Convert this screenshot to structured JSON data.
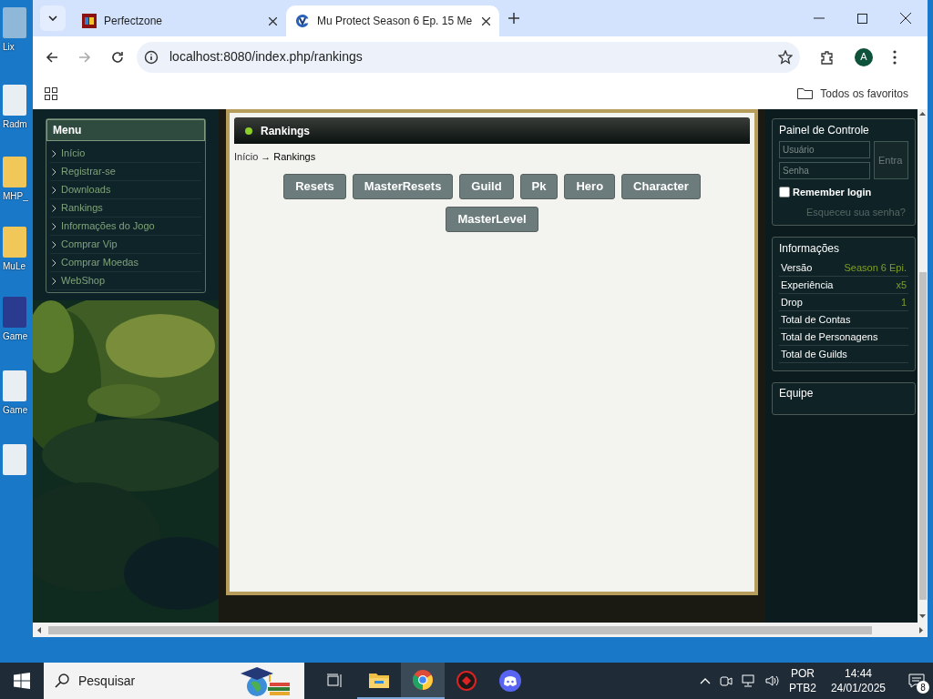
{
  "desktop_icons": [
    {
      "label": "Lix"
    },
    {
      "label": "Radm"
    },
    {
      "label": "MHP_"
    },
    {
      "label": "MuLe"
    },
    {
      "label": "Game"
    },
    {
      "label": "Game"
    }
  ],
  "browser": {
    "tabs": [
      {
        "title": "Perfectzone",
        "selected": false
      },
      {
        "title": "Mu Protect Season 6 Ep. 15 Me",
        "selected": true
      }
    ],
    "address": "localhost:8080/index.php/rankings",
    "profile_initial": "A",
    "bookmarks_folder": "Todos os favoritos"
  },
  "menu": {
    "title": "Menu",
    "items": [
      {
        "label": "Início"
      },
      {
        "label": "Registrar-se"
      },
      {
        "label": "Downloads"
      },
      {
        "label": "Rankings"
      },
      {
        "label": "Informações do Jogo"
      },
      {
        "label": "Comprar Vip"
      },
      {
        "label": "Comprar Moedas"
      },
      {
        "label": "WebShop"
      }
    ]
  },
  "content": {
    "title": "Rankings",
    "breadcrumb": {
      "home": "Início",
      "separator": "→",
      "current": "Rankings"
    },
    "buttons": [
      [
        "Resets",
        "MasterResets",
        "Guild",
        "Pk",
        "Hero",
        "Character"
      ],
      [
        "MasterLevel"
      ]
    ]
  },
  "login": {
    "title": "Painel de Controle",
    "username_placeholder": "Usuário",
    "password_placeholder": "Senha",
    "submit": "Entra",
    "remember": {
      "label": "Remember login",
      "checked": false
    },
    "forgot": "Esqueceu sua senha?"
  },
  "info": {
    "title": "Informações",
    "rows": [
      {
        "label": "Versão",
        "value": "Season 6 Epi."
      },
      {
        "label": "Experiência",
        "value": "x5"
      },
      {
        "label": "Drop",
        "value": "1"
      },
      {
        "label": "Total de Contas"
      },
      {
        "label": "Total de Personagens"
      },
      {
        "label": "Total de Guilds"
      }
    ]
  },
  "team": {
    "title": "Equipe"
  },
  "taskbar": {
    "search_placeholder": "Pesquisar",
    "language": "POR",
    "layout": "PTB2",
    "time": "14:44",
    "date": "24/01/2025",
    "notifications": "8"
  }
}
